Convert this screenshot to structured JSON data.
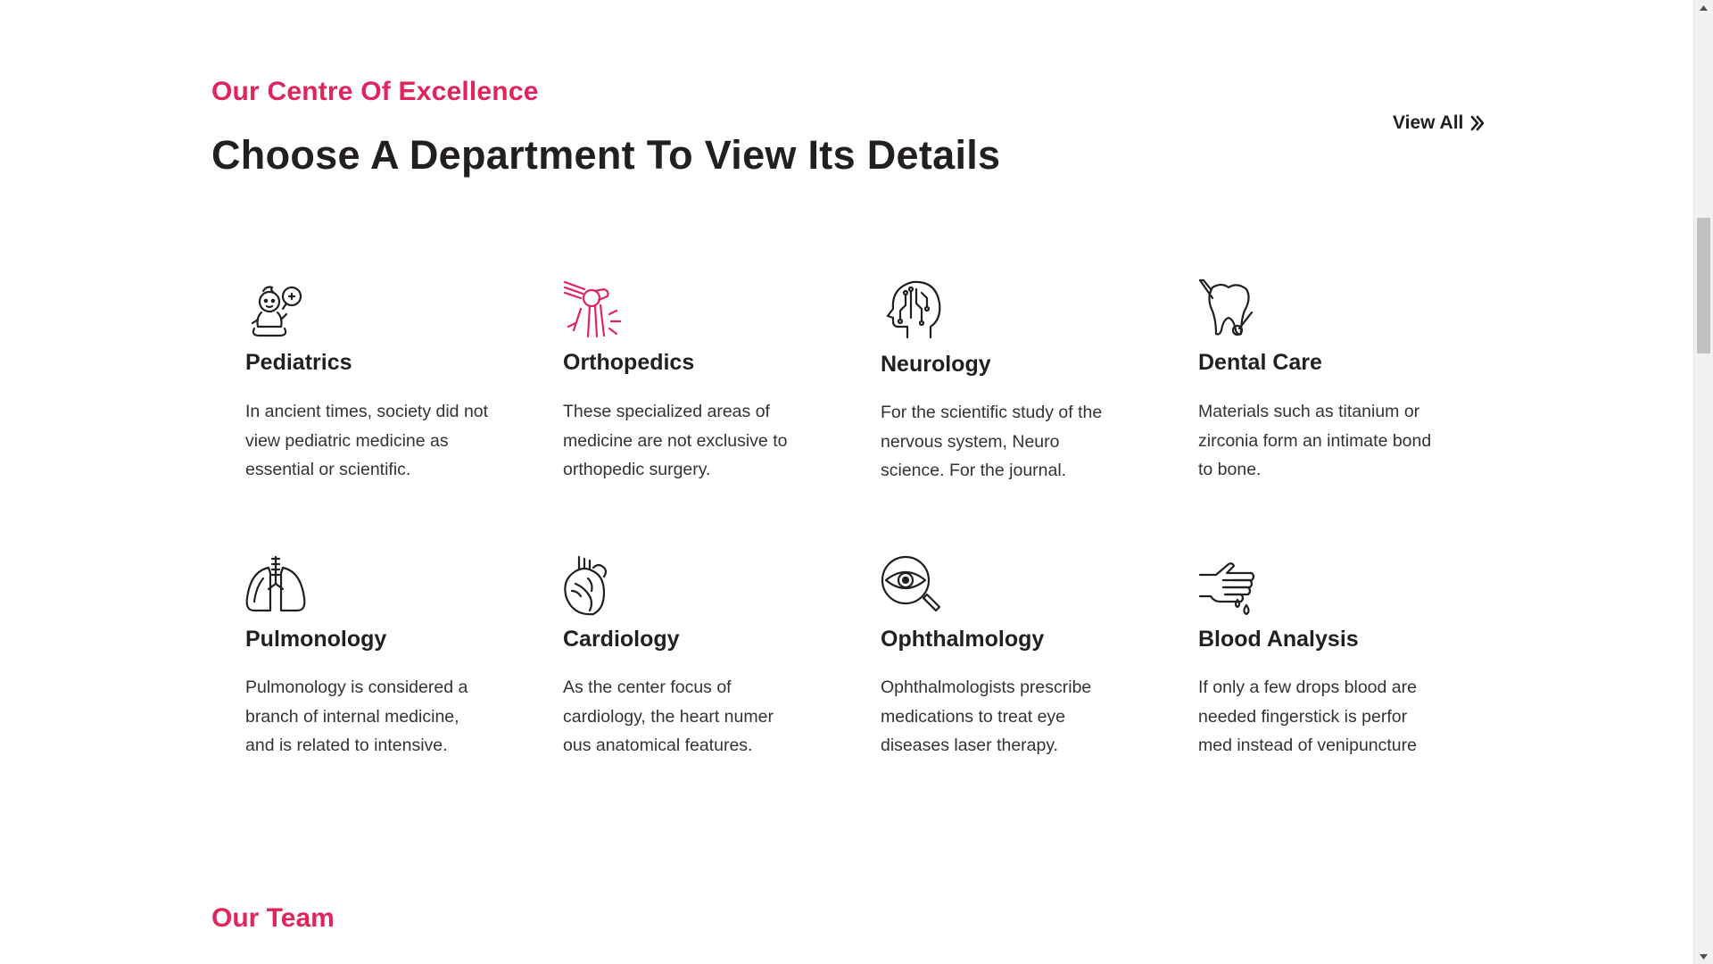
{
  "section": {
    "eyebrow": "Our Centre Of Excellence",
    "title": "Choose A Department To View Its Details",
    "view_all_label": "View All"
  },
  "departments": [
    {
      "name": "Pediatrics",
      "icon": "baby-icon",
      "lines": [
        "In ancient times, society did not",
        "view pediatric medicine as",
        "essential or scientific."
      ]
    },
    {
      "name": "Orthopedics",
      "icon": "knee-joint-icon",
      "lines": [
        "These specialized areas of",
        "medicine are not exclusive to",
        "orthopedic surgery."
      ]
    },
    {
      "name": "Neurology",
      "icon": "brain-circuit-icon",
      "lines": [
        "For the scientific study of the",
        "nervous system, Neuro",
        "science. For the journal."
      ]
    },
    {
      "name": "Dental Care",
      "icon": "tooth-tools-icon",
      "lines": [
        "Materials such as titanium or",
        "zirconia form an intimate bond",
        "to bone."
      ]
    },
    {
      "name": "Pulmonology",
      "icon": "lungs-icon",
      "lines": [
        "Pulmonology is considered a",
        "branch of internal medicine,",
        "and is related to intensive."
      ]
    },
    {
      "name": "Cardiology",
      "icon": "heart-anatomy-icon",
      "lines": [
        "As the center focus of",
        "cardiology, the heart numer",
        "ous anatomical features."
      ]
    },
    {
      "name": "Ophthalmology",
      "icon": "eye-magnifier-icon",
      "lines": [
        "Ophthalmologists prescribe",
        "medications to treat eye",
        "diseases laser therapy."
      ]
    },
    {
      "name": "Blood Analysis",
      "icon": "finger-blood-drop-icon",
      "lines": [
        "If only a few drops blood are",
        "needed fingerstick is perfor",
        "med instead of venipuncture"
      ]
    }
  ],
  "team": {
    "title": "Our Team"
  },
  "colors": {
    "accent": "#e0245e",
    "heading": "#231f20",
    "body_text": "#333333"
  }
}
